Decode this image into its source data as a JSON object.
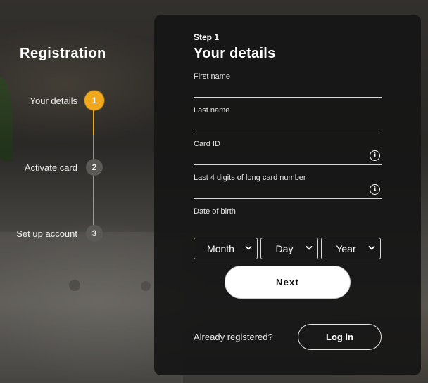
{
  "sidebar": {
    "title": "Registration",
    "steps": [
      {
        "number": "1",
        "label": "Your details",
        "state": "active"
      },
      {
        "number": "2",
        "label": "Activate card",
        "state": "pending"
      },
      {
        "number": "3",
        "label": "Set up account",
        "state": "pending"
      }
    ]
  },
  "form": {
    "step_tag": "Step 1",
    "title": "Your details",
    "fields": [
      {
        "label": "First name",
        "value": "",
        "info_icon": false
      },
      {
        "label": "Last name",
        "value": "",
        "info_icon": false
      },
      {
        "label": "Card ID",
        "value": "",
        "info_icon": true
      },
      {
        "label": "Last 4 digits of long card number",
        "value": "",
        "info_icon": true
      }
    ],
    "dob_label": "Date of birth",
    "dob_selects": {
      "month": "Month",
      "day": "Day",
      "year": "Year"
    },
    "next_label": "Next",
    "already_text": "Already registered?",
    "login_label": "Log in"
  },
  "colors": {
    "accent": "#f2a81d",
    "panel_bg": "#161616",
    "text": "#ffffff"
  },
  "icons": [
    "info-icon",
    "chevron-down-icon"
  ]
}
